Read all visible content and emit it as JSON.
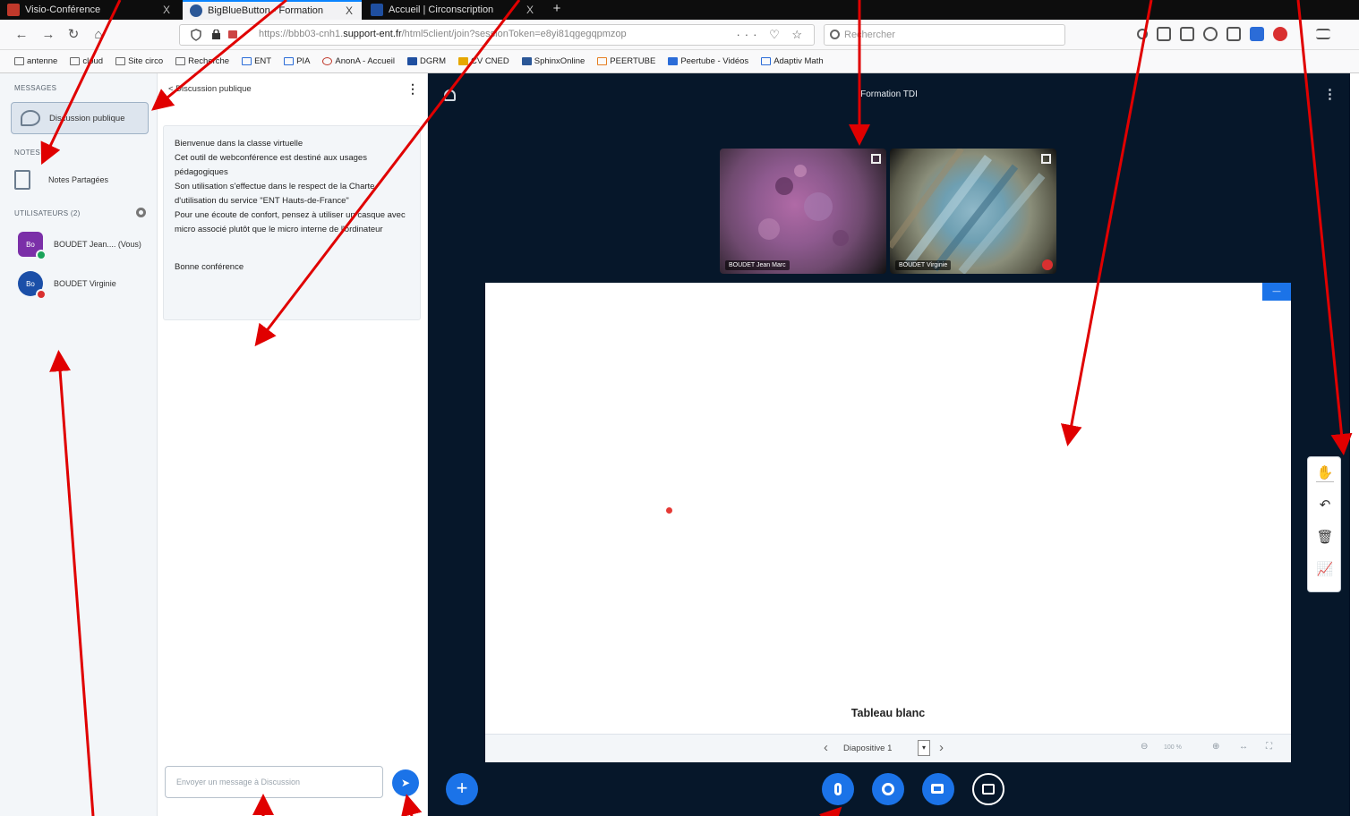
{
  "browser": {
    "tabs": [
      {
        "label": "Visio-Conférence",
        "close": "X",
        "color": "#c0392b"
      },
      {
        "label": "BigBlueButton - Formation",
        "close": "X",
        "color": "#2b5797"
      },
      {
        "label": "Accueil | Circonscription",
        "close": "X",
        "color": "#1f4fa0"
      }
    ],
    "new_tab": "+",
    "url_prefix": "https://bbb03-cnh1.",
    "url_domain": "support-ent.fr",
    "url_suffix": "/html5client/join?sessionToken=e8yi81qgegqpmzop",
    "url_actions": "··· ♡ ☆",
    "search_placeholder": "Rechercher",
    "bookmarks": [
      "antenne",
      "cloud",
      "Site circo",
      "Recherche",
      "ENT",
      "PIA",
      "AnonA - Accueil",
      "DGRM",
      "CV CNED",
      "SphinxOnline",
      "PEERTUBE",
      "Peertube - Vidéos",
      "Adaptiv Math"
    ]
  },
  "sidebar": {
    "messages_title": "MESSAGES",
    "public_chat": "Discussion publique",
    "notes_title": "NOTES",
    "shared_notes": "Notes Partagées",
    "users_title": "UTILISATEURS (2)",
    "users": [
      {
        "initials": "Bo",
        "name": "BOUDET Jean.... (Vous)",
        "color": "#7b2fa8",
        "badge": "#1aa35a"
      },
      {
        "initials": "Bo",
        "name": "BOUDET Virginie",
        "color": "#1b4fa8",
        "badge": "#d93030"
      }
    ]
  },
  "chat": {
    "header": "< Discussion publique",
    "menu": "⋮",
    "welcome": [
      "Bienvenue dans la classe virtuelle",
      "Cet outil de webconférence est destiné aux usages pédagogiques",
      "Son utilisation s'effectue dans le respect de la Charte d'utilisation du service \"ENT Hauts-de-France\"",
      "Pour une écoute de confort, pensez à utiliser un casque avec micro associé plutôt que le micro interne de l'ordinateur"
    ],
    "farewell": "Bonne conférence",
    "input_placeholder": "Envoyer un message à Discussion",
    "send_icon": "➤"
  },
  "main": {
    "title": "Formation TDI",
    "menu": "⋮",
    "videos": [
      {
        "name": "BOUDET Jean Marc"
      },
      {
        "name": "BOUDET Virginie"
      }
    ],
    "whiteboard_label": "Tableau blanc",
    "whiteboard_corner": "—",
    "slide_label": "Diapositive 1",
    "slide_dd": "▾",
    "prev": "‹",
    "next": "›",
    "zoom_value": "100 %",
    "tools": [
      "✋",
      "↶",
      "🗑",
      "📈"
    ],
    "plus": "+"
  },
  "colors": {
    "accent": "#1b73e8",
    "main_bg": "#06172a",
    "annotation": "#e00000"
  }
}
